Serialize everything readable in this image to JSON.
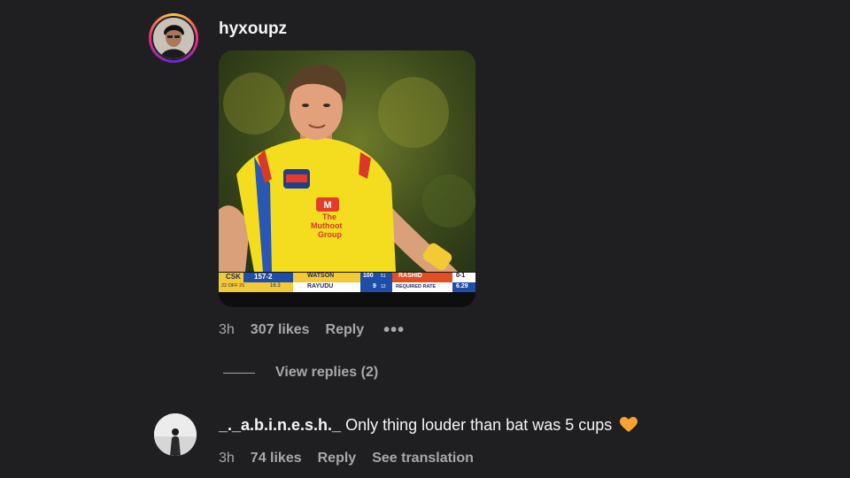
{
  "comments": [
    {
      "username": "hyxoupz",
      "time": "3h",
      "likes": "307 likes",
      "reply_label": "Reply",
      "more_label": "•••",
      "media": {
        "scoreboard": {
          "team": "CSK",
          "score": "157-2",
          "overs": "22 OFF 21",
          "run_rate": "16.3",
          "batter1": "WATSON",
          "batter1_runs": "100",
          "batter1_balls": "51",
          "batter2": "RAYUDU",
          "batter2_runs": "9",
          "batter2_balls": "12",
          "bowler": "RASHID",
          "bowler_figures": "0-1",
          "required_rate_label": "REQUIRED RATE",
          "required_rate": "6.29"
        },
        "sponsor_line1": "The",
        "sponsor_line2": "Muthoot",
        "sponsor_line3": "Group"
      }
    },
    {
      "username": "_._a.b.i.n.e.s.h._",
      "text": "Only thing louder than bat was 5 cups",
      "time": "3h",
      "likes": "74 likes",
      "reply_label": "Reply",
      "translation_label": "See translation"
    }
  ],
  "view_replies_label": "View replies (2)",
  "colors": {
    "background": "#1f1f22",
    "secondary_text": "#a8a8a8",
    "heart": "#f7a233"
  },
  "icons": {
    "heart": "orange-heart-icon"
  }
}
